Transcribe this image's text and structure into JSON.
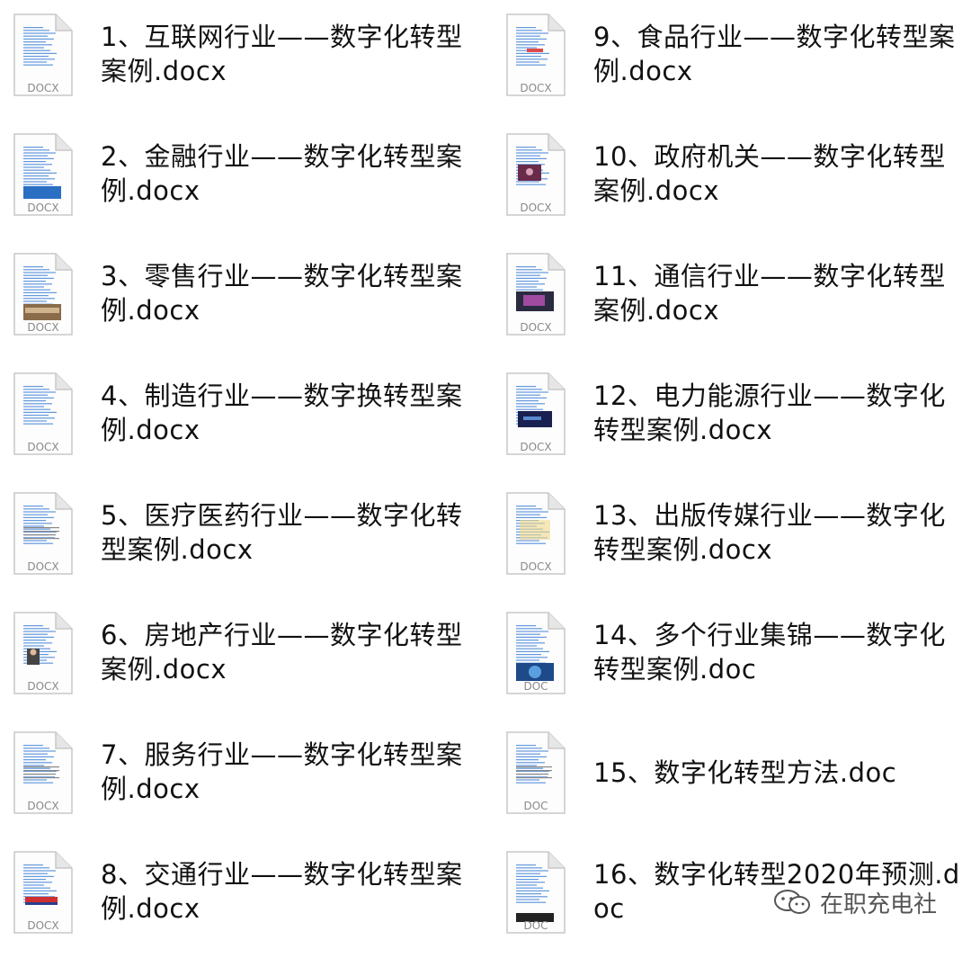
{
  "files": [
    {
      "name": "1、互联网行业——数字化转型案例.docx",
      "ext": "DOCX",
      "thumb": "plain"
    },
    {
      "name": "2、金融行业——数字化转型案例.docx",
      "ext": "DOCX",
      "thumb": "banner-blue"
    },
    {
      "name": "3、零售行业——数字化转型案例.docx",
      "ext": "DOCX",
      "thumb": "photo-store"
    },
    {
      "name": "4、制造行业——数字换转型案例.docx",
      "ext": "DOCX",
      "thumb": "plain"
    },
    {
      "name": "5、医疗医药行业——数字化转型案例.docx",
      "ext": "DOCX",
      "thumb": "plain-text"
    },
    {
      "name": "6、房地产行业——数字化转型案例.docx",
      "ext": "DOCX",
      "thumb": "portrait"
    },
    {
      "name": "7、服务行业——数字化转型案例.docx",
      "ext": "DOCX",
      "thumb": "plain-text"
    },
    {
      "name": "8、交通行业——数字化转型案例.docx",
      "ext": "DOCX",
      "thumb": "logo-southwest"
    },
    {
      "name": "9、食品行业——数字化转型案例.docx",
      "ext": "DOCX",
      "thumb": "red-mark"
    },
    {
      "name": "10、政府机关——数字化转型案例.docx",
      "ext": "DOCX",
      "thumb": "photo-stage"
    },
    {
      "name": "11、通信行业——数字化转型案例.docx",
      "ext": "DOCX",
      "thumb": "photo-screen"
    },
    {
      "name": "12、电力能源行业——数字化转型案例.docx",
      "ext": "DOCX",
      "thumb": "photo-dark"
    },
    {
      "name": "13、出版传媒行业——数字化转型案例.docx",
      "ext": "DOCX",
      "thumb": "yellow-text"
    },
    {
      "name": "14、多个行业集锦——数字化转型案例.doc",
      "ext": "DOC",
      "thumb": "photo-globe"
    },
    {
      "name": "15、数字化转型方法.doc",
      "ext": "DOC",
      "thumb": "plain-text"
    },
    {
      "name": "16、数字化转型2020年预测.doc",
      "ext": "DOC",
      "thumb": "dark-footer"
    }
  ],
  "watermark": {
    "text": "在职充电社",
    "icon": "wechat-icon"
  },
  "colors": {
    "text": "#111111",
    "icon_border": "#c8c8c8",
    "icon_fold": "#e6e6e6",
    "line_blue": "#3b7fd6",
    "label_gray": "#8a8a8a"
  }
}
